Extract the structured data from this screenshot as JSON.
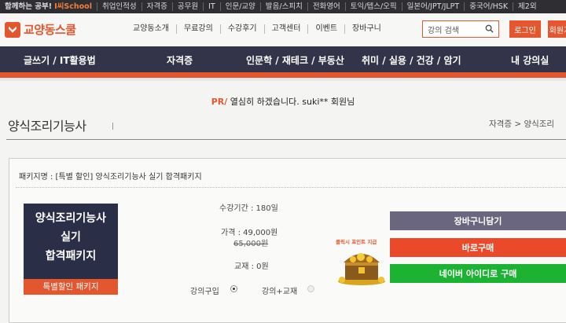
{
  "topbar": {
    "items": [
      "함께하는 공부!",
      "취업인적성",
      "자격증",
      "공무원",
      "IT",
      "인문/교양",
      "발음/스피치",
      "전화영어",
      "토익/텝스/오픽",
      "일본어/JPT/JLPT",
      "중국어/HSK",
      "제2외"
    ],
    "accent": "I씨School"
  },
  "header": {
    "logo_text": "교양동스쿨",
    "gnb": [
      "교양동소개",
      "무료강의",
      "수강후기",
      "고객센터",
      "이벤트",
      "장바구니"
    ],
    "search_placeholder": "강의 검색",
    "login": "로그인",
    "join": "회원가입"
  },
  "menu": [
    "글쓰기 / IT활용법",
    "자격증",
    "인문학 / 재테크 / 부동산",
    "취미 / 실용 / 건강 / 암기",
    "내 강의실"
  ],
  "welcome": {
    "pr": "PR/",
    "text": " 열심히 하겠습니다. suki** 회원님"
  },
  "page": {
    "title": "양식조리기능사",
    "breadcrumb": "자격증 > 양식조리"
  },
  "package": {
    "name": "패키지명 : [특별 할인] 양식조리기능사 실기 합격패키지",
    "cover_lines": [
      "양식조리기능사",
      "실기",
      "합격패키지"
    ],
    "cover_tag": "특별할인 패키지",
    "period": "수강기간 : 180일",
    "price": "가격 : 49,000원",
    "original_price": "65,000원",
    "textbook": "교재 : 0원",
    "option_course": "강의구입",
    "option_course_textbook": "강의+교재",
    "point_label": "클릭시 포인트 지급",
    "buttons": {
      "cart": "장바구니담기",
      "buy": "바로구매",
      "naver": "네이버 아이디로 구매"
    }
  },
  "colors": {
    "accent": "#e4572e",
    "nav": "#33334a",
    "cart": "#6a6680",
    "buy": "#ea4a2a",
    "naver": "#1db332"
  }
}
